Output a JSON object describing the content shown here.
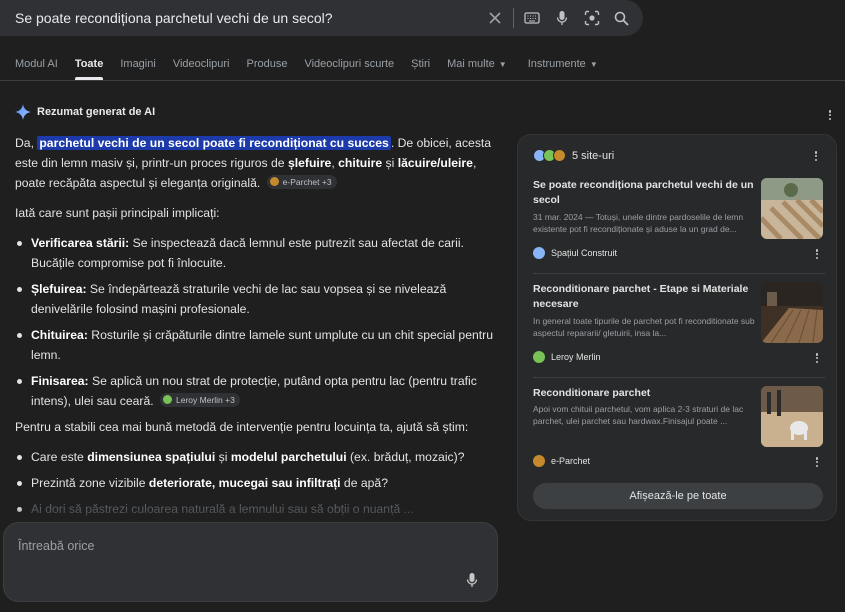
{
  "search": {
    "query": "Se poate reconditiona parchetul vechi de un secol?",
    "query_display": "Se poate recondiționa parchetul vechi de un secol?"
  },
  "icons": {
    "clear": "close-icon",
    "keyboard": "keyboard-icon",
    "mic": "mic-icon",
    "lens": "lens-icon",
    "search": "search-icon"
  },
  "tabs": [
    {
      "label": "Modul AI"
    },
    {
      "label": "Toate"
    },
    {
      "label": "Imagini"
    },
    {
      "label": "Videoclipuri"
    },
    {
      "label": "Produse"
    },
    {
      "label": "Videoclipuri scurte"
    },
    {
      "label": "Știri"
    },
    {
      "label": "Mai multe"
    },
    {
      "label": "Instrumente"
    }
  ],
  "ai_overview": {
    "header": "Rezumat generat de AI",
    "intro_before": "Da, ",
    "intro_highlight": "parchetul vechi de un secol poate fi recondiționat cu succes",
    "intro_after1": ". De obicei, acesta este din lemn masiv și, printr-un proces riguros de ",
    "intro_b1": "șlefuire",
    "intro_sep1": ", ",
    "intro_b2": "chituire",
    "intro_and": " și ",
    "intro_b3": "lăcuire/uleire",
    "intro_after2": ", poate recăpăta aspectul și eleganța originală.",
    "chip1": "e-Parchet +3",
    "steps_intro": "Iată care sunt pașii principali implicați:",
    "steps": [
      {
        "title": "Verificarea stării:",
        "text": " Se inspectează dacă lemnul este putrezit sau afectat de carii. Bucățile compromise pot fi înlocuite."
      },
      {
        "title": "Șlefuirea:",
        "text": " Se îndepărtează straturile vechi de lac sau vopsea și se nivelează denivelările folosind mașini profesionale."
      },
      {
        "title": "Chituirea:",
        "text": " Rosturile și crăpăturile dintre lamele sunt umplute cu un chit special pentru lemn."
      },
      {
        "title": "Finisarea:",
        "text": " Se aplică un nou strat de protecție, putând opta pentru lac (pentru trafic intens), ulei sau ceară."
      }
    ],
    "chip2": "Leroy Merlin +3",
    "para2": "Pentru a stabili cea mai bună metodă de intervenție pentru locuința ta, ajută să știm:",
    "q1_before": "Care este ",
    "q1_b1": "dimensiunea spațiului",
    "q1_mid": " și ",
    "q1_b2": "modelul parchetului",
    "q1_after": " (ex. brăduț, mozaic)?",
    "q2_before": "Prezintă zone vizibile ",
    "q2_b": "deteriorate, mucegai sau infiltrați",
    "q2_after": " de apă?",
    "q3_faded": "Ai dori să păstrezi culoarea naturală a lemnului sau să obții o nuanță ..."
  },
  "ask": {
    "placeholder": "Întreabă orice"
  },
  "sources": {
    "header": "5 site-uri",
    "cards": [
      {
        "title": "Se poate recondiționa parchetul vechi de un secol",
        "snippet": "31 mar. 2024 — Totuși, unele dintre pardoselile de lemn existente pot fi recondiționate și aduse la un grad de...",
        "source": "Spațiul Construit",
        "fav_color": "#8ab4f8"
      },
      {
        "title": "Reconditionare parchet - Etape si Materiale necesare",
        "snippet": "In general toate tipurile de parchet pot fi reconditionate sub aspectul repararii/ gletuirii, insa la...",
        "source": "Leroy Merlin",
        "fav_color": "#78c257"
      },
      {
        "title": "Reconditionare parchet",
        "snippet": "Apoi vom chituii parchetul, vom aplica 2-3 straturi de lac parchet, ulei parchet sau hardwax.Finisajul poate ...",
        "source": "e-Parchet",
        "fav_color": "#c58a2c"
      }
    ],
    "show_all": "Afișează-le pe toate"
  },
  "colors": {
    "background": "#1f1f1f",
    "highlight": "#1c3aa9",
    "panel": "#28292a"
  }
}
